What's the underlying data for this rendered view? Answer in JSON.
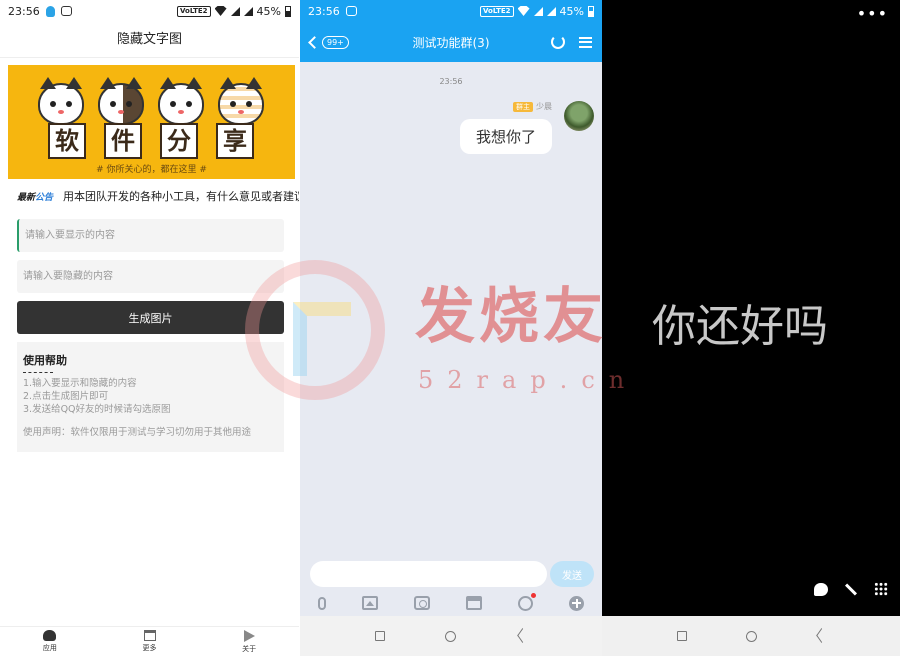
{
  "left": {
    "status": {
      "time": "23:56",
      "network": "VoLTE2",
      "battery": "45%"
    },
    "title": "隐藏文字图",
    "banner": {
      "tiles": [
        "软",
        "件",
        "分",
        "享"
      ],
      "slogan": "# 你所关心的，都在这里 #"
    },
    "notice": {
      "tag_part1": "最新",
      "tag_part2": "公告",
      "text": "用本团队开发的各种小工具，有什么意见或者建议可"
    },
    "inputs": {
      "show_placeholder": "请输入要显示的内容",
      "hide_placeholder": "请输入要隐藏的内容"
    },
    "generate_label": "生成图片",
    "help": {
      "title": "使用帮助",
      "steps": [
        "1.输入要显示和隐藏的内容",
        "2.点击生成图片即可",
        "3.发送给QQ好友的时候请勾选原图"
      ],
      "declaration": "使用声明：软件仅限用于测试与学习切勿用于其他用途"
    },
    "nav": {
      "app": "应用",
      "more": "更多",
      "about": "关于"
    }
  },
  "middle": {
    "status": {
      "time": "23:56",
      "network": "VoLTE2",
      "battery": "45%"
    },
    "badge": "99+",
    "title": "测试功能群(3)",
    "time": "23:56",
    "role": "群主",
    "sender": "少晨",
    "message": "我想你了",
    "send_label": "发送"
  },
  "right": {
    "more": "•••"
  },
  "watermark": {
    "title": "发烧友",
    "sub": "你还好吗",
    "url": "52rap.cn"
  },
  "colors": {
    "qq_blue": "#1aa3f2",
    "button_dark": "#333333",
    "banner_yellow": "#f6b60f",
    "send_disabled": "#bfe3f8",
    "role_tag": "#f6b93b"
  }
}
